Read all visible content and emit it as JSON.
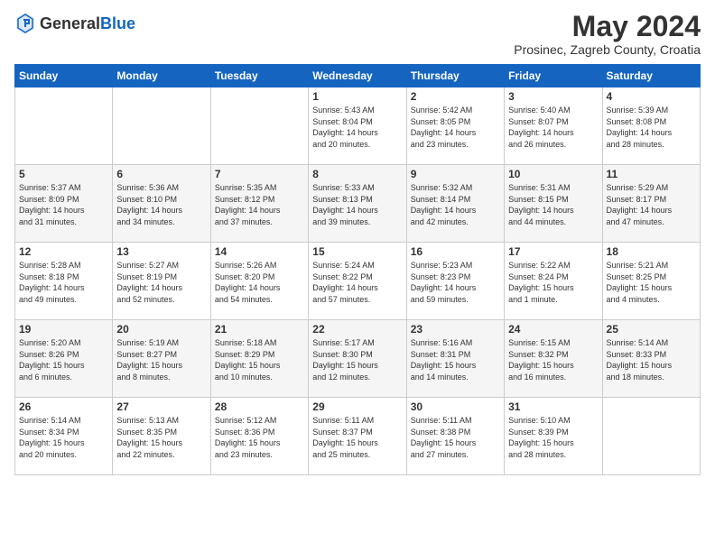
{
  "header": {
    "logo_general": "General",
    "logo_blue": "Blue",
    "month_title": "May 2024",
    "subtitle": "Prosinec, Zagreb County, Croatia"
  },
  "days_of_week": [
    "Sunday",
    "Monday",
    "Tuesday",
    "Wednesday",
    "Thursday",
    "Friday",
    "Saturday"
  ],
  "weeks": [
    [
      {
        "day": "",
        "info": ""
      },
      {
        "day": "",
        "info": ""
      },
      {
        "day": "",
        "info": ""
      },
      {
        "day": "1",
        "info": "Sunrise: 5:43 AM\nSunset: 8:04 PM\nDaylight: 14 hours\nand 20 minutes."
      },
      {
        "day": "2",
        "info": "Sunrise: 5:42 AM\nSunset: 8:05 PM\nDaylight: 14 hours\nand 23 minutes."
      },
      {
        "day": "3",
        "info": "Sunrise: 5:40 AM\nSunset: 8:07 PM\nDaylight: 14 hours\nand 26 minutes."
      },
      {
        "day": "4",
        "info": "Sunrise: 5:39 AM\nSunset: 8:08 PM\nDaylight: 14 hours\nand 28 minutes."
      }
    ],
    [
      {
        "day": "5",
        "info": "Sunrise: 5:37 AM\nSunset: 8:09 PM\nDaylight: 14 hours\nand 31 minutes."
      },
      {
        "day": "6",
        "info": "Sunrise: 5:36 AM\nSunset: 8:10 PM\nDaylight: 14 hours\nand 34 minutes."
      },
      {
        "day": "7",
        "info": "Sunrise: 5:35 AM\nSunset: 8:12 PM\nDaylight: 14 hours\nand 37 minutes."
      },
      {
        "day": "8",
        "info": "Sunrise: 5:33 AM\nSunset: 8:13 PM\nDaylight: 14 hours\nand 39 minutes."
      },
      {
        "day": "9",
        "info": "Sunrise: 5:32 AM\nSunset: 8:14 PM\nDaylight: 14 hours\nand 42 minutes."
      },
      {
        "day": "10",
        "info": "Sunrise: 5:31 AM\nSunset: 8:15 PM\nDaylight: 14 hours\nand 44 minutes."
      },
      {
        "day": "11",
        "info": "Sunrise: 5:29 AM\nSunset: 8:17 PM\nDaylight: 14 hours\nand 47 minutes."
      }
    ],
    [
      {
        "day": "12",
        "info": "Sunrise: 5:28 AM\nSunset: 8:18 PM\nDaylight: 14 hours\nand 49 minutes."
      },
      {
        "day": "13",
        "info": "Sunrise: 5:27 AM\nSunset: 8:19 PM\nDaylight: 14 hours\nand 52 minutes."
      },
      {
        "day": "14",
        "info": "Sunrise: 5:26 AM\nSunset: 8:20 PM\nDaylight: 14 hours\nand 54 minutes."
      },
      {
        "day": "15",
        "info": "Sunrise: 5:24 AM\nSunset: 8:22 PM\nDaylight: 14 hours\nand 57 minutes."
      },
      {
        "day": "16",
        "info": "Sunrise: 5:23 AM\nSunset: 8:23 PM\nDaylight: 14 hours\nand 59 minutes."
      },
      {
        "day": "17",
        "info": "Sunrise: 5:22 AM\nSunset: 8:24 PM\nDaylight: 15 hours\nand 1 minute."
      },
      {
        "day": "18",
        "info": "Sunrise: 5:21 AM\nSunset: 8:25 PM\nDaylight: 15 hours\nand 4 minutes."
      }
    ],
    [
      {
        "day": "19",
        "info": "Sunrise: 5:20 AM\nSunset: 8:26 PM\nDaylight: 15 hours\nand 6 minutes."
      },
      {
        "day": "20",
        "info": "Sunrise: 5:19 AM\nSunset: 8:27 PM\nDaylight: 15 hours\nand 8 minutes."
      },
      {
        "day": "21",
        "info": "Sunrise: 5:18 AM\nSunset: 8:29 PM\nDaylight: 15 hours\nand 10 minutes."
      },
      {
        "day": "22",
        "info": "Sunrise: 5:17 AM\nSunset: 8:30 PM\nDaylight: 15 hours\nand 12 minutes."
      },
      {
        "day": "23",
        "info": "Sunrise: 5:16 AM\nSunset: 8:31 PM\nDaylight: 15 hours\nand 14 minutes."
      },
      {
        "day": "24",
        "info": "Sunrise: 5:15 AM\nSunset: 8:32 PM\nDaylight: 15 hours\nand 16 minutes."
      },
      {
        "day": "25",
        "info": "Sunrise: 5:14 AM\nSunset: 8:33 PM\nDaylight: 15 hours\nand 18 minutes."
      }
    ],
    [
      {
        "day": "26",
        "info": "Sunrise: 5:14 AM\nSunset: 8:34 PM\nDaylight: 15 hours\nand 20 minutes."
      },
      {
        "day": "27",
        "info": "Sunrise: 5:13 AM\nSunset: 8:35 PM\nDaylight: 15 hours\nand 22 minutes."
      },
      {
        "day": "28",
        "info": "Sunrise: 5:12 AM\nSunset: 8:36 PM\nDaylight: 15 hours\nand 23 minutes."
      },
      {
        "day": "29",
        "info": "Sunrise: 5:11 AM\nSunset: 8:37 PM\nDaylight: 15 hours\nand 25 minutes."
      },
      {
        "day": "30",
        "info": "Sunrise: 5:11 AM\nSunset: 8:38 PM\nDaylight: 15 hours\nand 27 minutes."
      },
      {
        "day": "31",
        "info": "Sunrise: 5:10 AM\nSunset: 8:39 PM\nDaylight: 15 hours\nand 28 minutes."
      },
      {
        "day": "",
        "info": ""
      }
    ]
  ]
}
